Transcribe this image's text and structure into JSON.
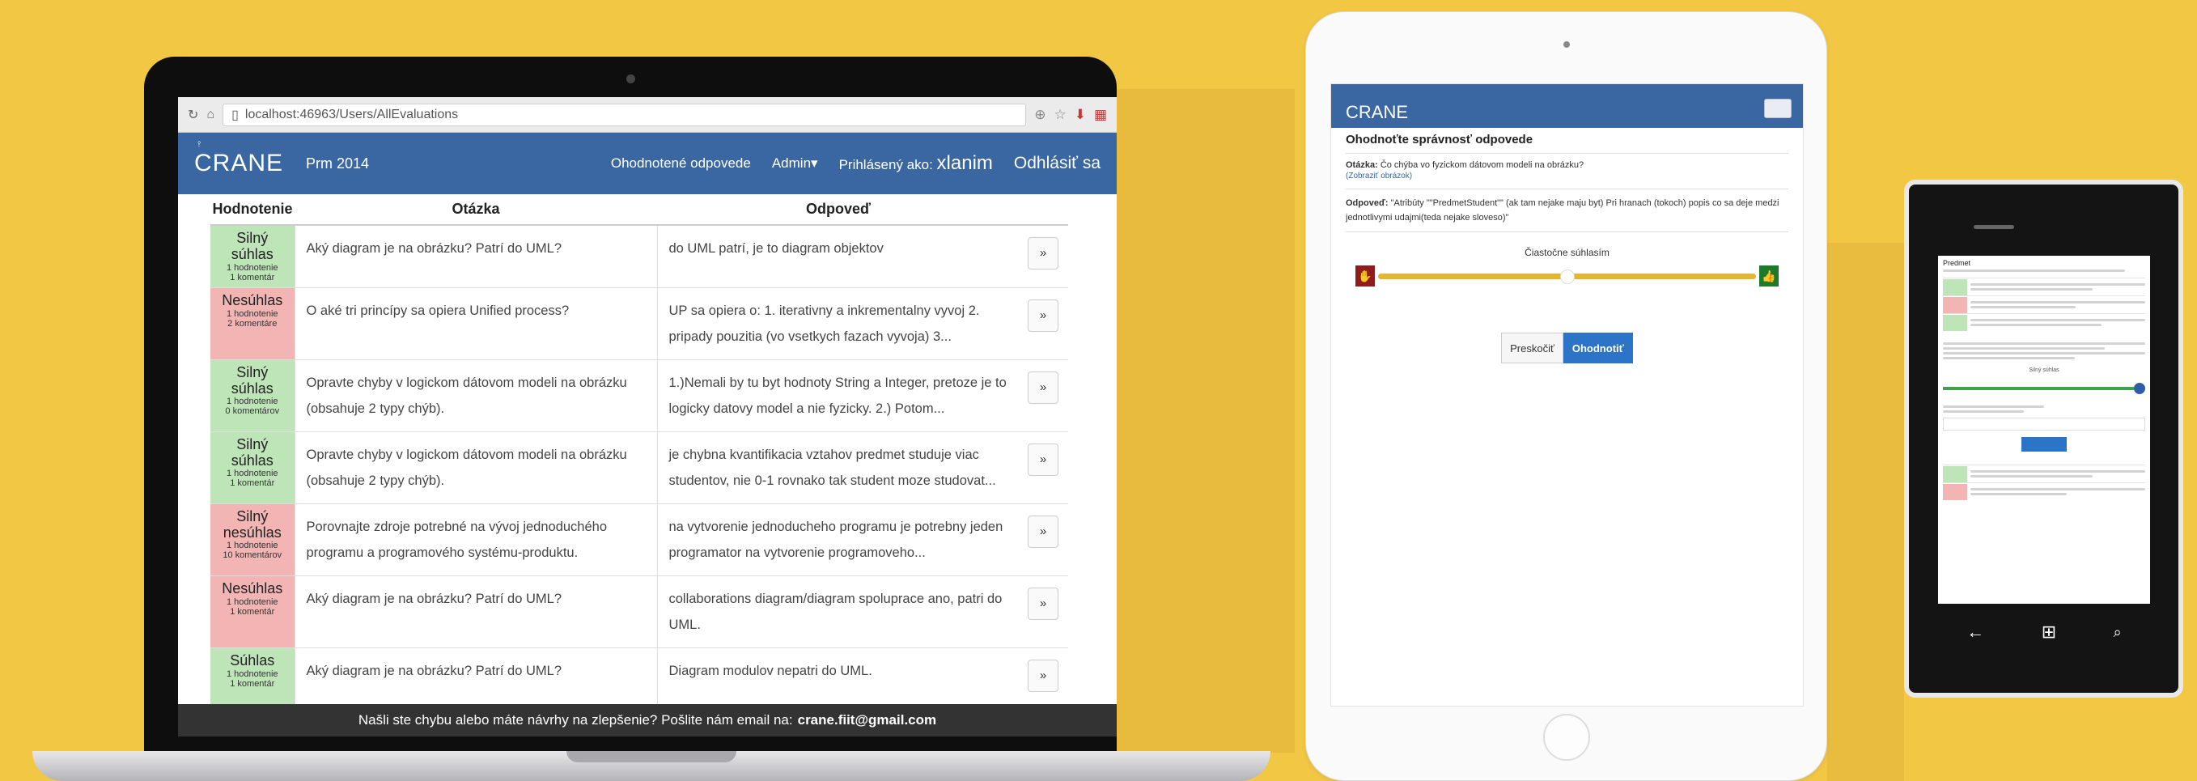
{
  "laptop": {
    "browser": {
      "url": "localhost:46963/Users/AllEvaluations"
    },
    "navbar": {
      "logo": "CRANE",
      "brand": "Prm 2014",
      "links": [
        "Ohodnotené odpovede",
        "Admin▾"
      ],
      "signed_in_prefix": "Prihlásený ako:",
      "username": "xlanim",
      "logout": "Odhlásiť sa"
    },
    "table": {
      "headers": [
        "Hodnotenie",
        "Otázka",
        "Odpoveď"
      ],
      "rows": [
        {
          "rating": "Silný súhlas",
          "ratings": "1 hodnotenie",
          "comments": "1 komentár",
          "color": "green",
          "question": "Aký diagram je na obrázku? Patrí do UML?",
          "answer": "do UML patrí, je to diagram objektov",
          "button": "»"
        },
        {
          "rating": "Nesúhlas",
          "ratings": "1 hodnotenie",
          "comments": "2 komentáre",
          "color": "red",
          "question": "O aké tri princípy sa opiera Unified process?",
          "answer": "UP sa opiera o: 1. iterativny a inkrementalny vyvoj 2. pripady pouzitia (vo vsetkych fazach vyvoja) 3...",
          "button": "»"
        },
        {
          "rating": "Silný súhlas",
          "ratings": "1 hodnotenie",
          "comments": "0 komentárov",
          "color": "green",
          "question": "Opravte chyby v logickom dátovom modeli na obrázku (obsahuje 2 typy chýb).",
          "answer": "1.)Nemali by tu byt hodnoty String a Integer, pretoze je to logicky datovy model a nie fyzicky. 2.) Potom...",
          "button": "»"
        },
        {
          "rating": "Silný súhlas",
          "ratings": "1 hodnotenie",
          "comments": "1 komentár",
          "color": "green",
          "question": "Opravte chyby v logickom dátovom modeli na obrázku (obsahuje 2 typy chýb).",
          "answer": "je chybna kvantifikacia vztahov predmet studuje viac studentov, nie 0-1 rovnako tak student moze studovat...",
          "button": "»"
        },
        {
          "rating": "Silný nesúhlas",
          "ratings": "1 hodnotenie",
          "comments": "10 komentárov",
          "color": "red",
          "question": "Porovnajte zdroje potrebné na vývoj jednoduchého programu a programového systému-produktu.",
          "answer": "na vytvorenie jednoducheho programu je potrebny jeden programator na vytvorenie programoveho...",
          "button": "»"
        },
        {
          "rating": "Nesúhlas",
          "ratings": "1 hodnotenie",
          "comments": "1 komentár",
          "color": "red",
          "question": "Aký diagram je na obrázku? Patrí do UML?",
          "answer": "collaborations diagram/diagram spoluprace ano, patri do UML.",
          "button": "»"
        },
        {
          "rating": "Súhlas",
          "ratings": "1 hodnotenie",
          "comments": "1 komentár",
          "color": "green",
          "question": "Aký diagram je na obrázku? Patrí do UML?",
          "answer": "Diagram modulov nepatri do UML.",
          "button": "»"
        }
      ]
    },
    "footer": {
      "text": "Našli ste chybu alebo máte návrhy na zlepšenie? Pošlite nám email na:",
      "email": "crane.fiit@gmail.com"
    }
  },
  "tablet": {
    "logo": "CRANE",
    "heading": "Ohodnoťte správnosť odpovede",
    "question_label": "Otázka:",
    "question": "Čo chýba vo fyzickom dátovom modeli na obrázku?",
    "show_image": "(Zobraziť obrázok)",
    "answer_label": "Odpoveď:",
    "answer": "\"Atribúty \"\"PredmetStudent\"\" (ak tam nejake maju byt) Pri hranach (tokoch) popis co sa deje medzi jednotlivymi udajmi(teda nejake sloveso)\"",
    "slider_label": "Čiastočne súhlasím",
    "slider_value": 0.5,
    "skip_button": "Preskočiť",
    "submit_button": "Ohodnotiť"
  },
  "phone": {
    "title": "Predmet",
    "slider_label": "Silný súhlas",
    "slider_value": 1.0
  },
  "colors": {
    "background": "#f2c744",
    "navbar": "#3a67a2",
    "agree": "#bde5b8",
    "disagree": "#f2b5b4",
    "slider": "#e2b533",
    "primary": "#2c74c8"
  }
}
